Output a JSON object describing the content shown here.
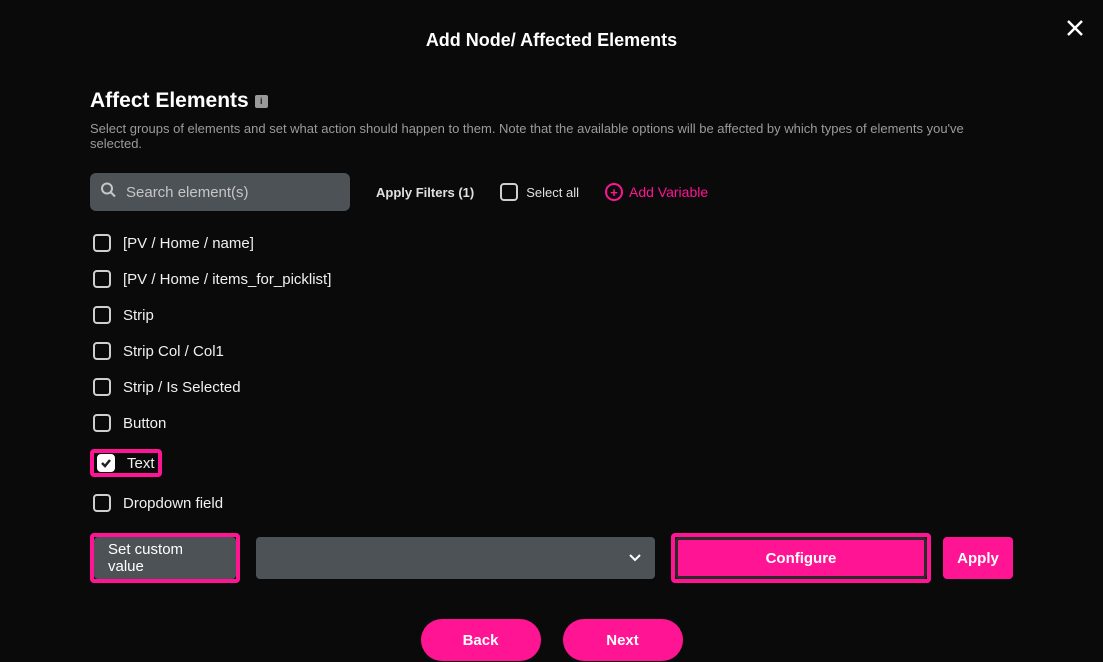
{
  "header": {
    "title": "Add Node/ Affected Elements"
  },
  "section": {
    "title": "Affect Elements",
    "desc": "Select groups of elements and set what action should happen to them. Note that the available options will be affected by which types of elements you've selected."
  },
  "filters": {
    "search_placeholder": "Search element(s)",
    "apply_filters": "Apply Filters (1)",
    "select_all": "Select all",
    "add_variable": "Add Variable"
  },
  "items": [
    {
      "label": "[PV / Home / name]",
      "checked": false,
      "highlighted": false
    },
    {
      "label": "[PV / Home / items_for_picklist]",
      "checked": false,
      "highlighted": false
    },
    {
      "label": "Strip",
      "checked": false,
      "highlighted": false
    },
    {
      "label": "Strip Col / Col1",
      "checked": false,
      "highlighted": false
    },
    {
      "label": "Strip / Is Selected",
      "checked": false,
      "highlighted": false
    },
    {
      "label": "Button",
      "checked": false,
      "highlighted": false
    },
    {
      "label": "Text",
      "checked": true,
      "highlighted": true
    },
    {
      "label": "Dropdown field",
      "checked": false,
      "highlighted": false
    }
  ],
  "action": {
    "select_value": "Set custom value",
    "configure_label": "Configure",
    "apply_label": "Apply"
  },
  "nav": {
    "back": "Back",
    "next": "Next"
  },
  "colors": {
    "accent": "#ff1493",
    "bg_field": "#4d5257",
    "bg_dark": "#0a0a0a"
  }
}
